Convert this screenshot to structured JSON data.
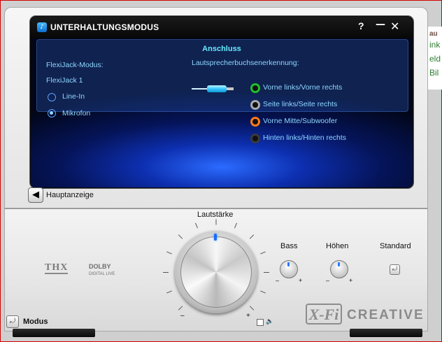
{
  "background_page": {
    "fragments": [
      "au",
      "ink",
      "eld",
      "Bil"
    ]
  },
  "window": {
    "title": "UNTERHALTUNGSMODUS",
    "help_label": "?",
    "minimize_label": "—",
    "close_label": "✕"
  },
  "panel": {
    "section_title": "Anschluss",
    "flexijack_heading": "FlexiJack-Modus:",
    "flexijack_value": "FlexiJack 1",
    "options": [
      {
        "label": "Line-In",
        "selected": false
      },
      {
        "label": "Mikrofon",
        "selected": true
      }
    ],
    "detection_heading": "Lautsprecherbuchsenerkennung:",
    "jacks": [
      {
        "label": "Vorne links/Vorne rechts",
        "color": "#1fc22a"
      },
      {
        "label": "Seite links/Seite rechts",
        "color": "#a9a9a9"
      },
      {
        "label": "Vorne Mitte/Subwoofer",
        "color": "#ff7a1a"
      },
      {
        "label": "Hinten links/Hinten rechts",
        "color": "#3a3a3a"
      }
    ]
  },
  "nav": {
    "back_label": "Hauptanzeige",
    "back_icon": "arrow-left-icon"
  },
  "controls": {
    "volume_label": "Lautstärke",
    "bass_label": "Bass",
    "treble_label": "Höhen",
    "standard_label": "Standard",
    "minus": "–",
    "plus": "+"
  },
  "branding": {
    "thx": "THX",
    "dolby": "DOLBY",
    "dolby_sub": "DIGITAL LIVE",
    "xfi": "X-Fi",
    "creative": "CREATIVE"
  },
  "footer": {
    "mode_label": "Modus"
  }
}
